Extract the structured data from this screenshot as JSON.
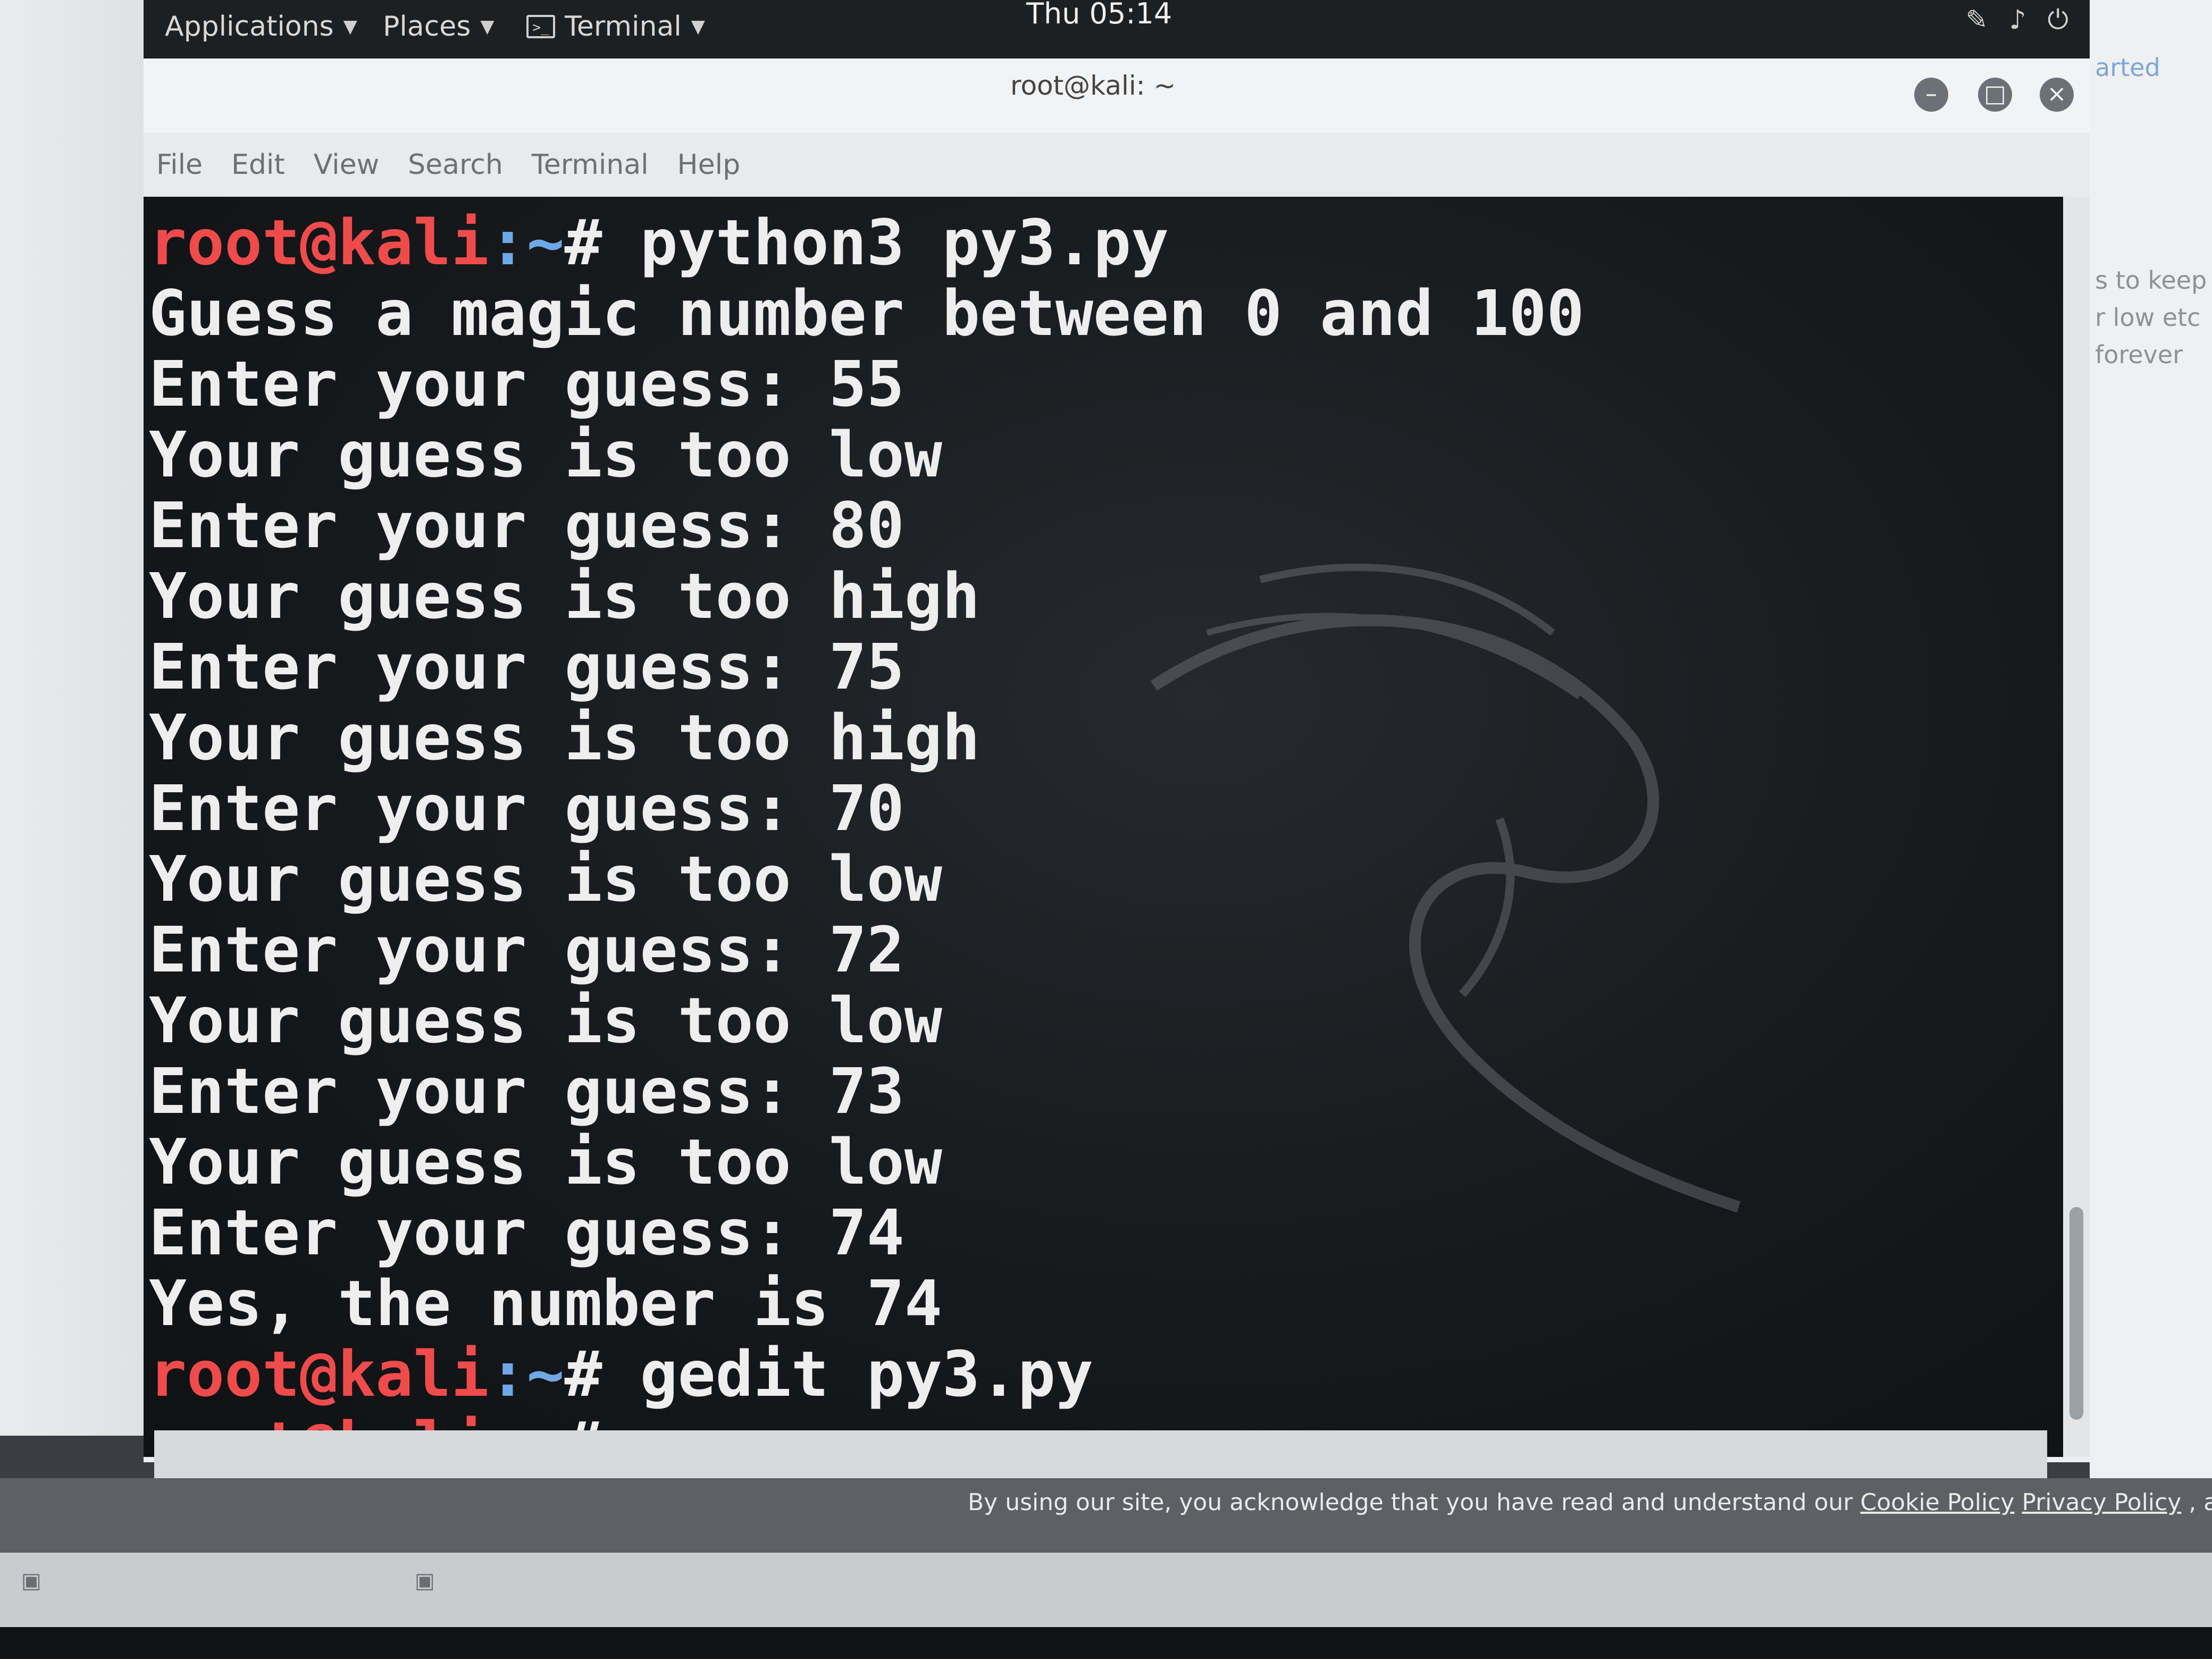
{
  "topbar": {
    "applications": "Applications",
    "places": "Places",
    "terminal": "Terminal",
    "clock": "Thu 05:14"
  },
  "window": {
    "title": "root@kali: ~",
    "menu": [
      "File",
      "Edit",
      "View",
      "Search",
      "Terminal",
      "Help"
    ]
  },
  "terminal": {
    "lines": [
      {
        "user": "root@kali",
        "path": ":~",
        "text": "# python3 py3.py"
      },
      {
        "text": "Guess a magic number between 0 and 100"
      },
      {
        "text": "Enter your guess: 55"
      },
      {
        "text": "Your guess is too low"
      },
      {
        "text": "Enter your guess: 80"
      },
      {
        "text": "Your guess is too high"
      },
      {
        "text": "Enter your guess: 75"
      },
      {
        "text": "Your guess is too high"
      },
      {
        "text": "Enter your guess: 70"
      },
      {
        "text": "Your guess is too low"
      },
      {
        "text": "Enter your guess: 72"
      },
      {
        "text": "Your guess is too low"
      },
      {
        "text": "Enter your guess: 73"
      },
      {
        "text": "Your guess is too low"
      },
      {
        "text": "Enter your guess: 74"
      },
      {
        "text": "Yes, the number is 74"
      },
      {
        "user": "root@kali",
        "path": ":~",
        "text": "# gedit py3.py"
      },
      {
        "user": "root@kali",
        "path": ":~",
        "text": "#"
      }
    ]
  },
  "background_page": {
    "link": "arted",
    "snippets": [
      "s to keep",
      "r low etc",
      "forever"
    ]
  },
  "cookie_notice": {
    "text": "By using our site, you acknowledge that you have read and understand our",
    "cookie_policy": "Cookie Policy",
    "privacy_policy": "Privacy Policy",
    "tail": ", and our"
  },
  "colors": {
    "prompt_user": "#f04b4b",
    "prompt_path": "#6fa8e6",
    "terminal_text": "#eeeeee",
    "terminal_bg": "#17191c"
  }
}
